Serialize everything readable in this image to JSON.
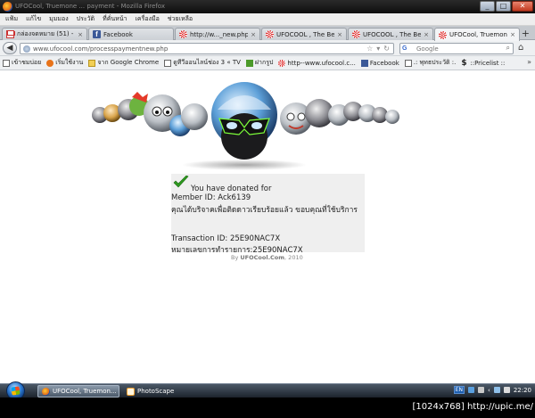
{
  "window": {
    "title": "UFOCool, Truemone ... payment - Mozilla Firefox",
    "minimize_label": "_",
    "maximize_label": "□",
    "close_label": "✕"
  },
  "menu": {
    "items": [
      "แฟ้ม",
      "แก้ไข",
      "มุมมอง",
      "ประวัติ",
      "ที่คั่นหน้า",
      "เครื่องมือ",
      "ช่วยเหลือ"
    ]
  },
  "tabs": [
    {
      "label": "กล่องจดหมาย (51) - ...",
      "icon": "gmail-icon"
    },
    {
      "label": "Facebook",
      "icon": "facebook-icon"
    },
    {
      "label": "http://w..._new.php",
      "icon": "ufocool-icon"
    },
    {
      "label": "UFOCOOL , The Bes...",
      "icon": "ufocool-icon"
    },
    {
      "label": "UFOCOOL , The Bes...",
      "icon": "ufocool-icon"
    },
    {
      "label": "UFOCool, Truemone...",
      "icon": "ufocool-icon",
      "active": true
    }
  ],
  "tab_close_label": "×",
  "new_tab_label": "+",
  "navigation": {
    "back_label": "◀",
    "url_prefix": "www.",
    "url": "www.ufocool.com/processpaymentnew.php",
    "search_placeholder": "Google",
    "search_engine": "G"
  },
  "bookmarks": [
    {
      "label": "เข้าชมบ่อย",
      "icon": "page-icon"
    },
    {
      "label": "เริ่มใช้งาน",
      "icon": "firefox-icon"
    },
    {
      "label": "จาก Google Chrome",
      "icon": "folder-icon"
    },
    {
      "label": "ดูทีวีออนไลน์ช่อง 3 « TV",
      "icon": "page-icon"
    },
    {
      "label": "ฝากรูป",
      "icon": "photo-icon"
    },
    {
      "label": "http--www.ufocool.c...",
      "icon": "ufocool-icon"
    },
    {
      "label": "Facebook",
      "icon": "facebook-icon"
    },
    {
      "label": ".: พุทธประวัติ :.",
      "icon": "page-icon"
    },
    {
      "label": "::Pricelist ::",
      "icon": "dollar-icon"
    }
  ],
  "bookmarks_more": "»",
  "donation": {
    "headline": "You have donated for",
    "member_id": "Member ID: Ack6139",
    "thanks_th": "คุณได้บริจาคเพื่อติดดาวเรียบร้อยแล้ว ขอบคุณที่ใช้บริการ",
    "transaction_id": "Transaction ID: 25E90NAC7X",
    "transaction_th": "หมายเลขการทำรายการ:25E90NAC7X",
    "credit_prefix": "By",
    "credit_site": "UFOCool.Com",
    "credit_year": ", 2010",
    "status_color": "#2e9a1f"
  },
  "taskbar": {
    "buttons": [
      {
        "label": "UFOCool, Truemon...",
        "icon": "firefox-icon",
        "active": true
      },
      {
        "label": "PhotoScape",
        "icon": "photoscape-icon",
        "active": false
      }
    ],
    "tray": {
      "lang": "EN",
      "clock": "22:20"
    }
  },
  "caption": "[1024x768] http://upic.me/"
}
